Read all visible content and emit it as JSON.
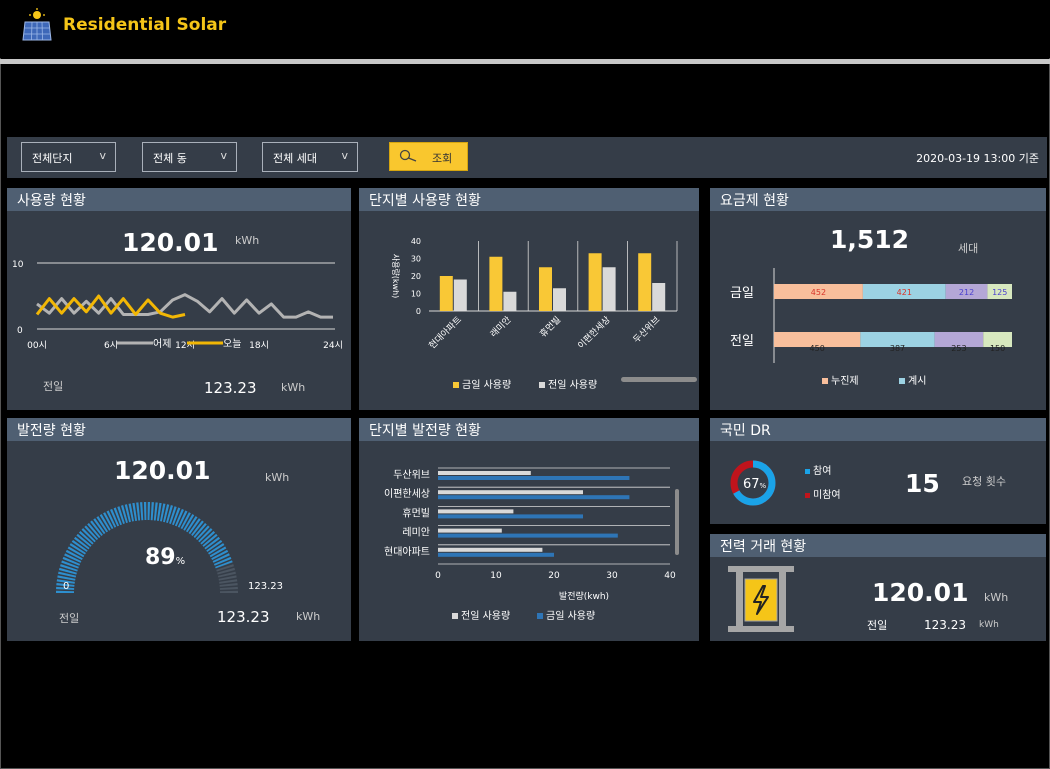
{
  "app": {
    "title": "Residential Solar"
  },
  "filters": {
    "complex": "전체단지",
    "building": "전체 동",
    "household": "전체 세대",
    "search_label": "조회",
    "timestamp": "2020-03-19 13:00 기준"
  },
  "usage": {
    "title": "사용량 현황",
    "value": "120.01",
    "unit": "kWh",
    "prev_label": "전일",
    "prev_value": "123.23",
    "prev_unit": "kWh",
    "chart_data": {
      "type": "line",
      "title": "",
      "ylim": [
        0,
        10
      ],
      "yticks": [
        "10",
        "0"
      ],
      "xticks": [
        "00시",
        "6시",
        "12시",
        "18시",
        "24시"
      ],
      "x": [
        0,
        1,
        2,
        3,
        4,
        5,
        6,
        7,
        8,
        9,
        10,
        11,
        12,
        13,
        14,
        15,
        16,
        17,
        18,
        19,
        20,
        21,
        22,
        23,
        24
      ],
      "series": [
        {
          "name": "어제",
          "color": "#b3b3b3",
          "values": [
            3.8,
            2.4,
            4.6,
            2.4,
            4.2,
            2.4,
            4.6,
            2.2,
            2.2,
            2.2,
            2.6,
            4.4,
            5.2,
            4.2,
            2.6,
            4.6,
            2.4,
            4.4,
            2.4,
            3.8,
            1.8,
            1.8,
            2.6,
            1.8,
            1.8
          ]
        },
        {
          "name": "오늘",
          "color": "#f2b705",
          "values": [
            2.2,
            4.6,
            2.4,
            4.6,
            2.6,
            5.0,
            2.4,
            4.6,
            2.2,
            4.4,
            2.4,
            1.8,
            2.2
          ]
        }
      ],
      "legend": "bottom"
    }
  },
  "complex_usage": {
    "title": "단지별 사용량 현황",
    "chart_data": {
      "type": "bar",
      "ylabel": "사용량(kwh)",
      "ylim": [
        0,
        40
      ],
      "yticks": [
        "40",
        "30",
        "20",
        "10",
        "0"
      ],
      "categories": [
        "현대아파트",
        "래미안",
        "휴먼빌",
        "이편한세상",
        "두산위브"
      ],
      "series": [
        {
          "name": "금일 사용량",
          "color": "#f9c836",
          "values": [
            20,
            31,
            25,
            33,
            33
          ]
        },
        {
          "name": "전일 사용량",
          "color": "#d9d9d9",
          "values": [
            18,
            11,
            13,
            25,
            16
          ]
        }
      ],
      "legend": "bottom"
    }
  },
  "rate_plan": {
    "title": "요금제 현황",
    "value": "1,512",
    "unit": "세대",
    "chart_data": {
      "type": "bar",
      "orientation": "horizontal-stacked",
      "categories": [
        "금일",
        "전일"
      ],
      "series": [
        {
          "name": "누진제",
          "color": "#f8bf9c",
          "values": [
            452,
            450
          ]
        },
        {
          "name": "계시",
          "color": "#9cd2e3",
          "values": [
            421,
            387
          ]
        },
        {
          "name": "",
          "color": "#b4a7d6",
          "values": [
            212,
            253
          ]
        },
        {
          "name": "",
          "color": "#d7e8bf",
          "values": [
            125,
            150
          ]
        }
      ],
      "label_colors": [
        "#d9352a",
        "#d9352a",
        "#4a3fcf",
        "#4a3fcf"
      ],
      "legend": "bottom"
    }
  },
  "generation": {
    "title": "발전량 현황",
    "value": "120.01",
    "unit": "kWh",
    "percent": "89",
    "percent_unit": "%",
    "percent_fraction": 0.89,
    "gauge_min": "0",
    "gauge_max": "123.23",
    "prev_label": "전일",
    "prev_value": "123.23",
    "prev_unit": "kWh"
  },
  "complex_generation": {
    "title": "단지별 발전량 현황",
    "chart_data": {
      "type": "bar",
      "orientation": "horizontal",
      "xlabel": "발전량(kwh)",
      "xlim": [
        0,
        40
      ],
      "xticks": [
        "0",
        "10",
        "20",
        "30",
        "40"
      ],
      "categories": [
        "두산위브",
        "이편한세상",
        "휴먼빌",
        "레미안",
        "현대아파트"
      ],
      "series": [
        {
          "name": "전일 사용량",
          "color": "#d9d9d9",
          "values": [
            16,
            25,
            13,
            11,
            18
          ]
        },
        {
          "name": "금일 사용량",
          "color": "#2e75b6",
          "values": [
            33,
            33,
            25,
            31,
            20
          ]
        }
      ],
      "legend": "bottom"
    }
  },
  "dr": {
    "title": "국민 DR",
    "percent": "67",
    "percent_unit": "%",
    "participate_fraction": 0.67,
    "legend_join": "참여",
    "legend_nonjoin": "미참여",
    "join_color": "#1aa3e8",
    "nonjoin_color": "#c0141c",
    "count": "15",
    "count_label": "요청 횟수"
  },
  "trade": {
    "title": "전력 거래 현황",
    "value": "120.01",
    "unit": "kWh",
    "prev_label": "전일",
    "prev_value": "123.23",
    "prev_unit": "kWh"
  }
}
